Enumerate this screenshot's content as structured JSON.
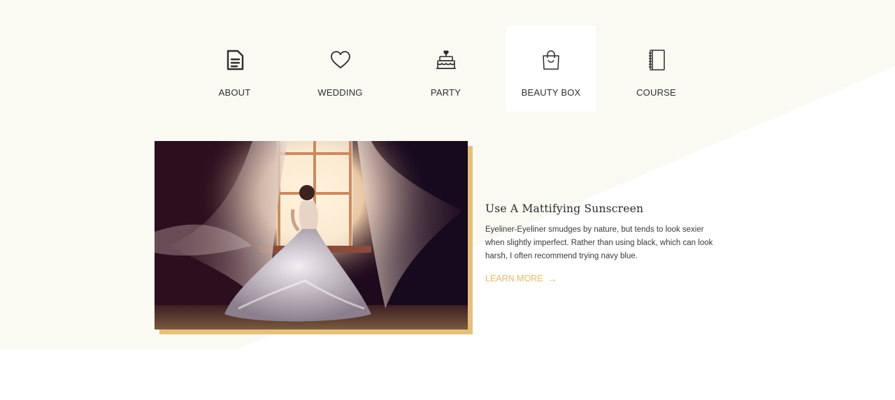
{
  "tabs": [
    {
      "label": "ABOUT",
      "icon": "document-icon",
      "active": false
    },
    {
      "label": "WEDDING",
      "icon": "heart-icon",
      "active": false
    },
    {
      "label": "PARTY",
      "icon": "cake-icon",
      "active": false
    },
    {
      "label": "BEAUTY BOX",
      "icon": "shopping-bag-icon",
      "active": true
    },
    {
      "label": "COURSE",
      "icon": "notebook-icon",
      "active": false
    }
  ],
  "article": {
    "title": "Use A Mattifying Sunscreen",
    "body": "Eyeliner-Eyeliner smudges by nature, but tends to look sexier when slightly imperfect. Rather than using black, which can look harsh, I often recommend trying navy blue.",
    "link_label": "LEARN MORE",
    "link_arrow": "→",
    "image_subject": "bride-in-white-gown-at-window"
  },
  "colors": {
    "accent": "#e6b96a",
    "cream_background": "#fafaf3",
    "photo_frame": "#e6c07b"
  }
}
